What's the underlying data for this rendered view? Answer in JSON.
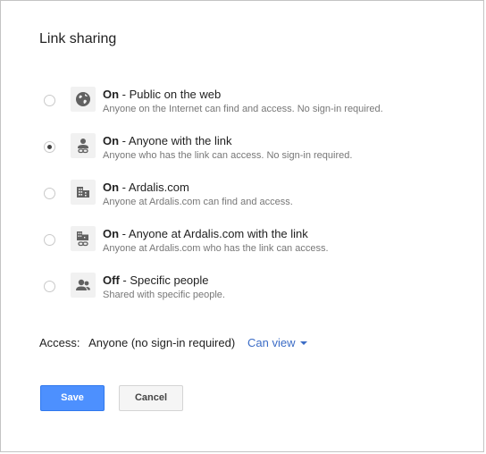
{
  "dialog": {
    "title": "Link sharing"
  },
  "options": [
    {
      "state": "On",
      "separator": " - ",
      "label": "Public on the web",
      "description": "Anyone on the Internet can find and access. No sign-in required.",
      "icon": "globe-icon",
      "selected": false
    },
    {
      "state": "On",
      "separator": " - ",
      "label": "Anyone with the link",
      "description": "Anyone who has the link can access. No sign-in required.",
      "icon": "person-link-icon",
      "selected": true
    },
    {
      "state": "On",
      "separator": " - ",
      "label": "Ardalis.com",
      "description": "Anyone at Ardalis.com can find and access.",
      "icon": "building-icon",
      "selected": false
    },
    {
      "state": "On",
      "separator": " - ",
      "label": "Anyone at Ardalis.com with the link",
      "description": "Anyone at Ardalis.com who has the link can access.",
      "icon": "building-link-icon",
      "selected": false
    },
    {
      "state": "Off",
      "separator": " - ",
      "label": "Specific people",
      "description": "Shared with specific people.",
      "icon": "people-icon",
      "selected": false
    }
  ],
  "access": {
    "label": "Access:",
    "value": "Anyone (no sign-in required)",
    "permission": "Can view"
  },
  "buttons": {
    "save": "Save",
    "cancel": "Cancel"
  },
  "colors": {
    "primary_button": "#4d90fe",
    "link": "#3b6cc6",
    "icon": "#616161"
  }
}
